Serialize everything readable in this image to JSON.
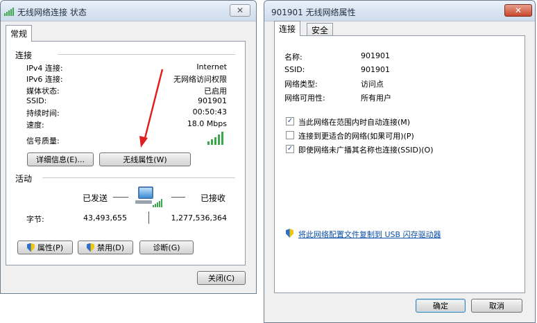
{
  "status_window": {
    "title": "无线网络连接 状态",
    "close_label": "✕",
    "tab_general": "常规",
    "connection_section": "连接",
    "rows": [
      {
        "label": "IPv4 连接:",
        "value": "Internet"
      },
      {
        "label": "IPv6 连接:",
        "value": "无网络访问权限"
      },
      {
        "label": "媒体状态:",
        "value": "已启用"
      },
      {
        "label": "SSID:",
        "value": "901901"
      },
      {
        "label": "持续时间:",
        "value": "00:50:43"
      },
      {
        "label": "速度:",
        "value": "18.0 Mbps"
      }
    ],
    "signal_label": "信号质量:",
    "details_button": "详细信息(E)...",
    "wireless_props_button": "无线属性(W)",
    "activity_section": "活动",
    "sent_label": "已发送",
    "received_label": "已接收",
    "bytes_label": "字节:",
    "bytes_sent": "43,493,655",
    "bytes_received": "1,277,536,364",
    "properties_button": "属性(P)",
    "disable_button": "禁用(D)",
    "diagnose_button": "诊断(G)",
    "close_button": "关闭(C)"
  },
  "props_window": {
    "title": "901901 无线网络属性",
    "close_label": "✕",
    "tab_connection": "连接",
    "tab_security": "安全",
    "fields": [
      {
        "label": "名称:",
        "value": "901901"
      },
      {
        "label": "SSID:",
        "value": "901901"
      },
      {
        "label": "网络类型:",
        "value": "访问点"
      },
      {
        "label": "网络可用性:",
        "value": "所有用户"
      }
    ],
    "checkboxes": [
      {
        "label": "当此网络在范围内时自动连接(M)",
        "checked": true,
        "mark": "✓"
      },
      {
        "label": "连接到更适合的网络(如果可用)(P)",
        "checked": false,
        "mark": ""
      },
      {
        "label": "即使网络未广播其名称也连接(SSID)(O)",
        "checked": true,
        "mark": "✓"
      }
    ],
    "copy_link": "将此网络配置文件复制到 USB 闪存驱动器",
    "ok_button": "确定",
    "cancel_button": "取消"
  },
  "colors": {
    "arrow": "#e02020",
    "signal": "#3aa84a",
    "link": "#0b4fa8"
  }
}
